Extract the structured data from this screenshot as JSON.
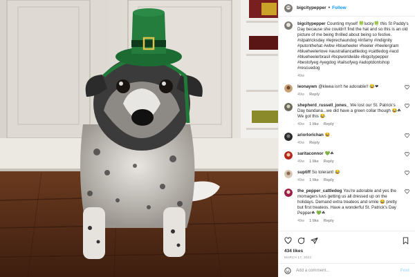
{
  "post": {
    "username": "bigcitypepper",
    "follow_label": "Follow",
    "caption_text": "Counting myself 🍀lucky🍀 this St Paddy's Day because she couldn't find the hat and so this is an old picture of me being thrilled about being so festive. #stpatricksday #leprechaundog #infamy #indignity #putonthehat #wbw #blueheeler #heeler #heelergram #blueheelerlove #australiancattledog #cattledog #acd #blueheelerbrasil #bcpworldwide #bigcitypepper #bestofyeg #yegdog #tailsofyeg #adoptdontshop #rescuedog",
    "caption_age": "49w"
  },
  "comments": [
    {
      "user": "leonaywn",
      "text": "@kiwea isn't he adorable!! 😂❤",
      "age": "49w",
      "likes": "",
      "reply": "Reply"
    },
    {
      "user": "shepherd_russell_jones_",
      "text": "We lost our St. Patrick's Day bandana...we did have a green collar though 😂☘ We got this 😂",
      "age": "49w",
      "likes": "1 like",
      "reply": "Reply"
    },
    {
      "user": "ariorlorichan",
      "text": "😆",
      "age": "49w",
      "likes": "",
      "reply": "Reply"
    },
    {
      "user": "saritaconnor",
      "text": "💚☘",
      "age": "49w",
      "likes": "1 like",
      "reply": "Reply"
    },
    {
      "user": "suptiff",
      "text": "So tolerant! 😂",
      "age": "49w",
      "likes": "1 like",
      "reply": "Reply"
    },
    {
      "user": "the_pepper_cattledog",
      "text": "You're adorable and yes the momagers luvs getting us all dressed up on the holidays. Demand extra treateos and smile 😂 pretty but first treateos. Have a wonderful St. Patrick's Day Pepper☘ 💚☘",
      "age": "49w",
      "likes": "1 like",
      "reply": "Reply"
    }
  ],
  "footer": {
    "likes": "434 likes",
    "date": "March 17, 2021",
    "add_comment_placeholder": "Add a comment...",
    "post_label": "Post"
  },
  "icons": [
    "heart-icon",
    "comment-icon",
    "share-icon",
    "bookmark-icon",
    "emoji-icon"
  ],
  "colors": {
    "link": "#0095f6",
    "muted": "#8e8e8e",
    "hat_green": "#1f7a3a"
  }
}
